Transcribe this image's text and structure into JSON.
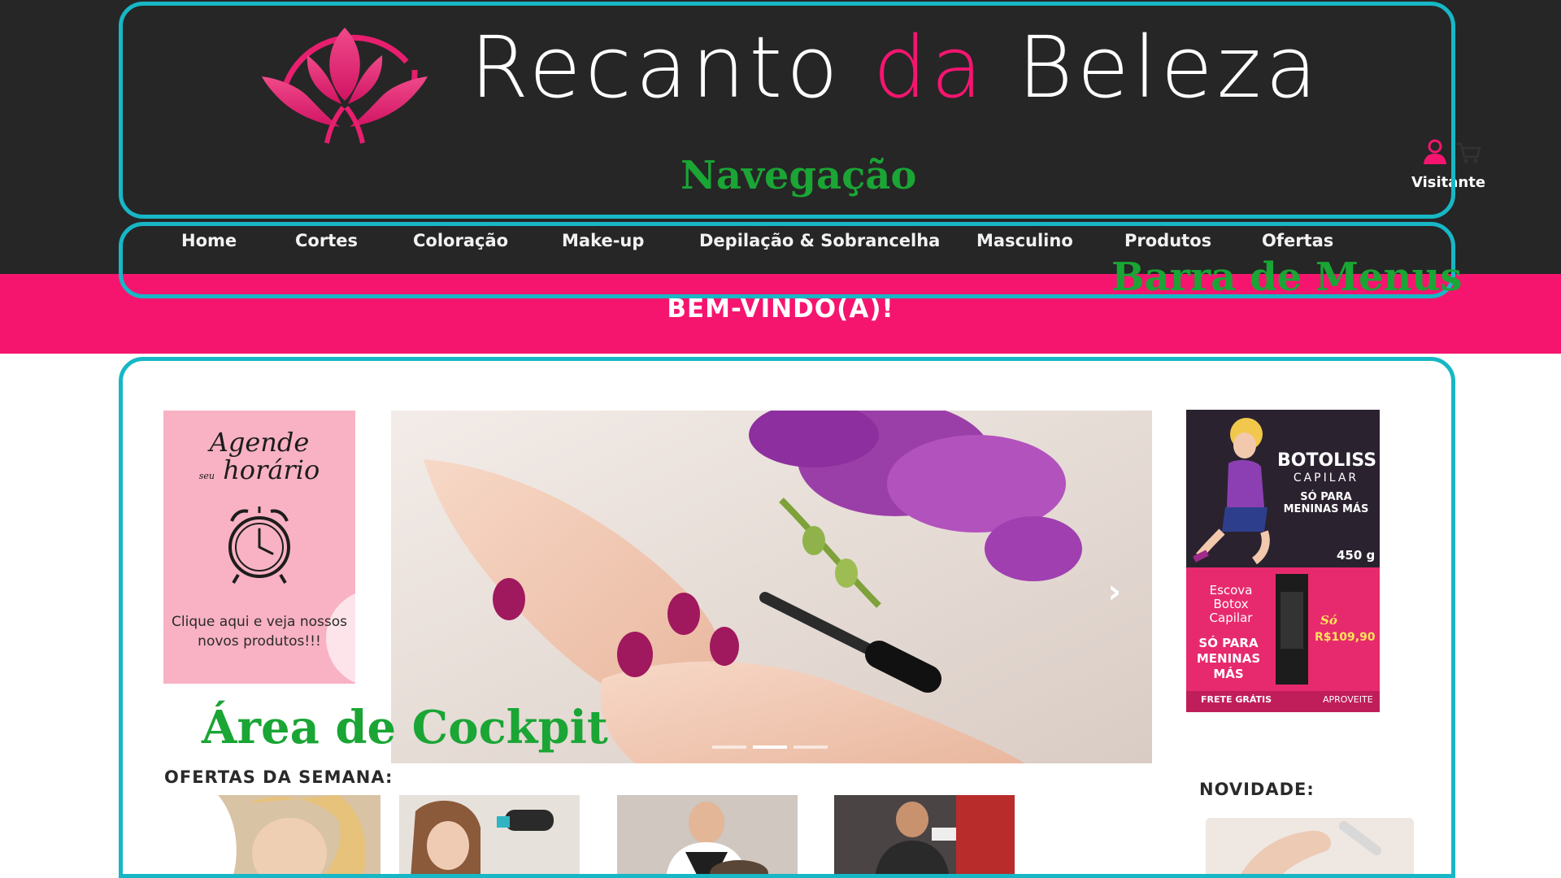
{
  "brand": {
    "part1": "Recanto ",
    "part2": "da",
    "part3": " Beleza"
  },
  "user": {
    "label": "Visitante"
  },
  "nav": {
    "items": [
      {
        "label": "Home"
      },
      {
        "label": "Cortes"
      },
      {
        "label": "Coloração"
      },
      {
        "label": "Make-up"
      },
      {
        "label": "Depilação & Sobrancelha"
      },
      {
        "label": "Masculino"
      },
      {
        "label": "Produtos"
      },
      {
        "label": "Ofertas"
      }
    ]
  },
  "welcome": "BEM-VINDO(A)!",
  "promo_left": {
    "title_line1": "Agende",
    "title_small": "seu",
    "title_line2": "horário",
    "caption": "Clique aqui e veja nossos novos produtos!!!"
  },
  "carousel": {
    "slides": 3,
    "active_slide": 2
  },
  "promo_right": {
    "brand": "BOTOLISS",
    "brand_sub": "CAPILAR",
    "tagline": "SÓ PARA MENINAS MÁS",
    "weight": "450 g",
    "escova": "Escova Botox Capilar",
    "meninas": "SÓ PARA MENINAS MÁS",
    "so": "Só",
    "price": "R$109,90",
    "frete": "FRETE GRÁTIS",
    "aproveite": "APROVEITE"
  },
  "sections": {
    "offers_title": "OFERTAS DA SEMANA:",
    "novidade_title": "NOVIDADE:"
  },
  "annotations": {
    "navegacao": "Navegação",
    "barra_menus": "Barra de Menus",
    "cockpit": "Área de Cockpit"
  },
  "colors": {
    "header_bg": "#262626",
    "accent_pink": "#f5156f",
    "annotation_border": "#17b7c5",
    "annotation_text": "#1aa535"
  }
}
